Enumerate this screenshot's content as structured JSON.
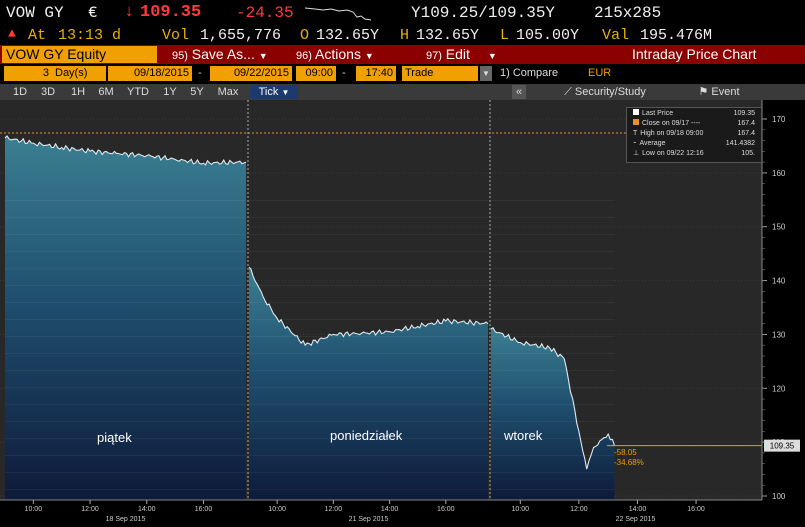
{
  "ticker": {
    "symbol": "VOW GY",
    "currency_symbol": "€",
    "arrow": "↓",
    "last": "109.35",
    "change": "-24.35",
    "bid_ask": "Y109.25/109.35Y",
    "size": "215x285",
    "at_label": "At",
    "time": "13:13 d",
    "vol_label": "Vol",
    "vol": "1,655,776",
    "open_label": "O",
    "open": "132.65Y",
    "high_label": "H",
    "high": "132.65Y",
    "low_label": "L",
    "low": "105.00Y",
    "val_label": "Val",
    "val": "195.476M"
  },
  "menubar": {
    "equity": "VOW GY Equity",
    "save_key": "95)",
    "save": "Save As...",
    "actions_key": "96)",
    "actions": "Actions",
    "edit_key": "97)",
    "edit": "Edit",
    "title": "Intraday Price Chart"
  },
  "params": {
    "days_count": "3",
    "days_unit": "Day(s)",
    "start_date": "09/18/2015",
    "end_date": "09/22/2015",
    "start_time": "09:00",
    "end_time": "17:40",
    "field": "Trade",
    "compare": "1) Compare",
    "currency": "EUR"
  },
  "periods": {
    "buttons": [
      "1D",
      "3D",
      "1H",
      "6M",
      "YTD",
      "1Y",
      "5Y",
      "Max"
    ],
    "tick": "Tick",
    "collapse": "«",
    "security_study": "Security/Study",
    "event": "Event"
  },
  "legend": {
    "rows": [
      {
        "label": "Last Price",
        "value": "109.35"
      },
      {
        "label": "Close on 09/17 ----",
        "value": "167.4"
      },
      {
        "label": "High on 09/18 09:00",
        "value": "167.4"
      },
      {
        "label": "Average",
        "value": "141.4382"
      },
      {
        "label": "Low on 09/22 12:16",
        "value": "105."
      }
    ]
  },
  "annotations": {
    "day1": "piątek",
    "day2": "poniedziałek",
    "day3": "wtorek",
    "change_abs": "-58.05",
    "change_pct": "-34.68%",
    "last_tag": "109.35"
  },
  "chart_data": {
    "type": "area",
    "yticks": [
      "170",
      "160",
      "150",
      "140",
      "130",
      "120",
      "110",
      "100"
    ],
    "ylim": [
      100,
      170
    ],
    "xtick_labels": [
      "10:00",
      "12:00",
      "14:00",
      "16:00",
      "10:00",
      "12:00",
      "14:00",
      "16:00",
      "10:00",
      "12:00",
      "14:00",
      "16:00"
    ],
    "date_labels": [
      "18 Sep 2015",
      "21 Sep 2015",
      "22 Sep 2015"
    ],
    "previous_close": 167.4,
    "last_price": 109.35,
    "series": [
      {
        "session": "18 Sep 2015",
        "x": [
          "09:00",
          "10:00",
          "11:00",
          "12:00",
          "13:00",
          "14:00",
          "15:00",
          "16:00",
          "17:30"
        ],
        "y": [
          166.5,
          165.5,
          164.7,
          164.0,
          163.6,
          163.2,
          162.5,
          161.8,
          162.0
        ]
      },
      {
        "session": "21 Sep 2015",
        "x": [
          "09:00",
          "09:30",
          "10:00",
          "11:00",
          "12:00",
          "13:00",
          "14:00",
          "15:00",
          "16:00",
          "17:30"
        ],
        "y": [
          142.5,
          137.0,
          133.0,
          128.0,
          130.0,
          130.2,
          130.5,
          131.5,
          132.5,
          132.0
        ]
      },
      {
        "session": "22 Sep 2015",
        "x": [
          "09:00",
          "10:00",
          "11:00",
          "11:30",
          "12:00",
          "12:16",
          "12:30",
          "13:00",
          "13:13"
        ],
        "y": [
          131.0,
          128.5,
          127.5,
          125.5,
          112.0,
          105.0,
          109.0,
          111.5,
          109.35
        ]
      }
    ]
  }
}
